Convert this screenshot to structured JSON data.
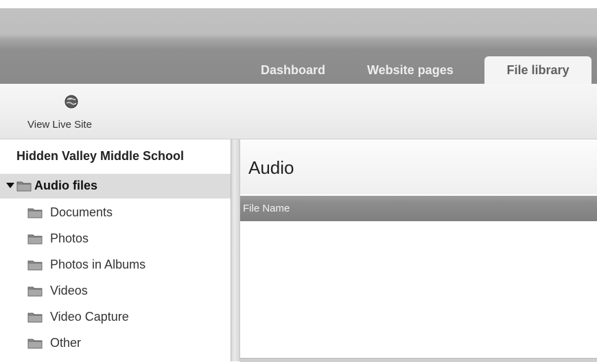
{
  "header": {
    "tabs": [
      {
        "label": "Dashboard",
        "active": false
      },
      {
        "label": "Website pages",
        "active": false
      },
      {
        "label": "File library",
        "active": true
      }
    ]
  },
  "toolbar": {
    "view_live_site": {
      "label": "View Live Site",
      "icon": "globe-icon"
    }
  },
  "sidebar": {
    "site_name": "Hidden Valley Middle School",
    "folders": [
      {
        "label": "Audio files",
        "selected": true,
        "expanded": true
      },
      {
        "label": "Documents",
        "selected": false
      },
      {
        "label": "Photos",
        "selected": false
      },
      {
        "label": "Photos in Albums",
        "selected": false
      },
      {
        "label": "Videos",
        "selected": false
      },
      {
        "label": "Video Capture",
        "selected": false
      },
      {
        "label": "Other",
        "selected": false
      }
    ]
  },
  "main": {
    "title": "Audio",
    "table": {
      "columns": [
        "File Name"
      ],
      "rows": []
    }
  }
}
